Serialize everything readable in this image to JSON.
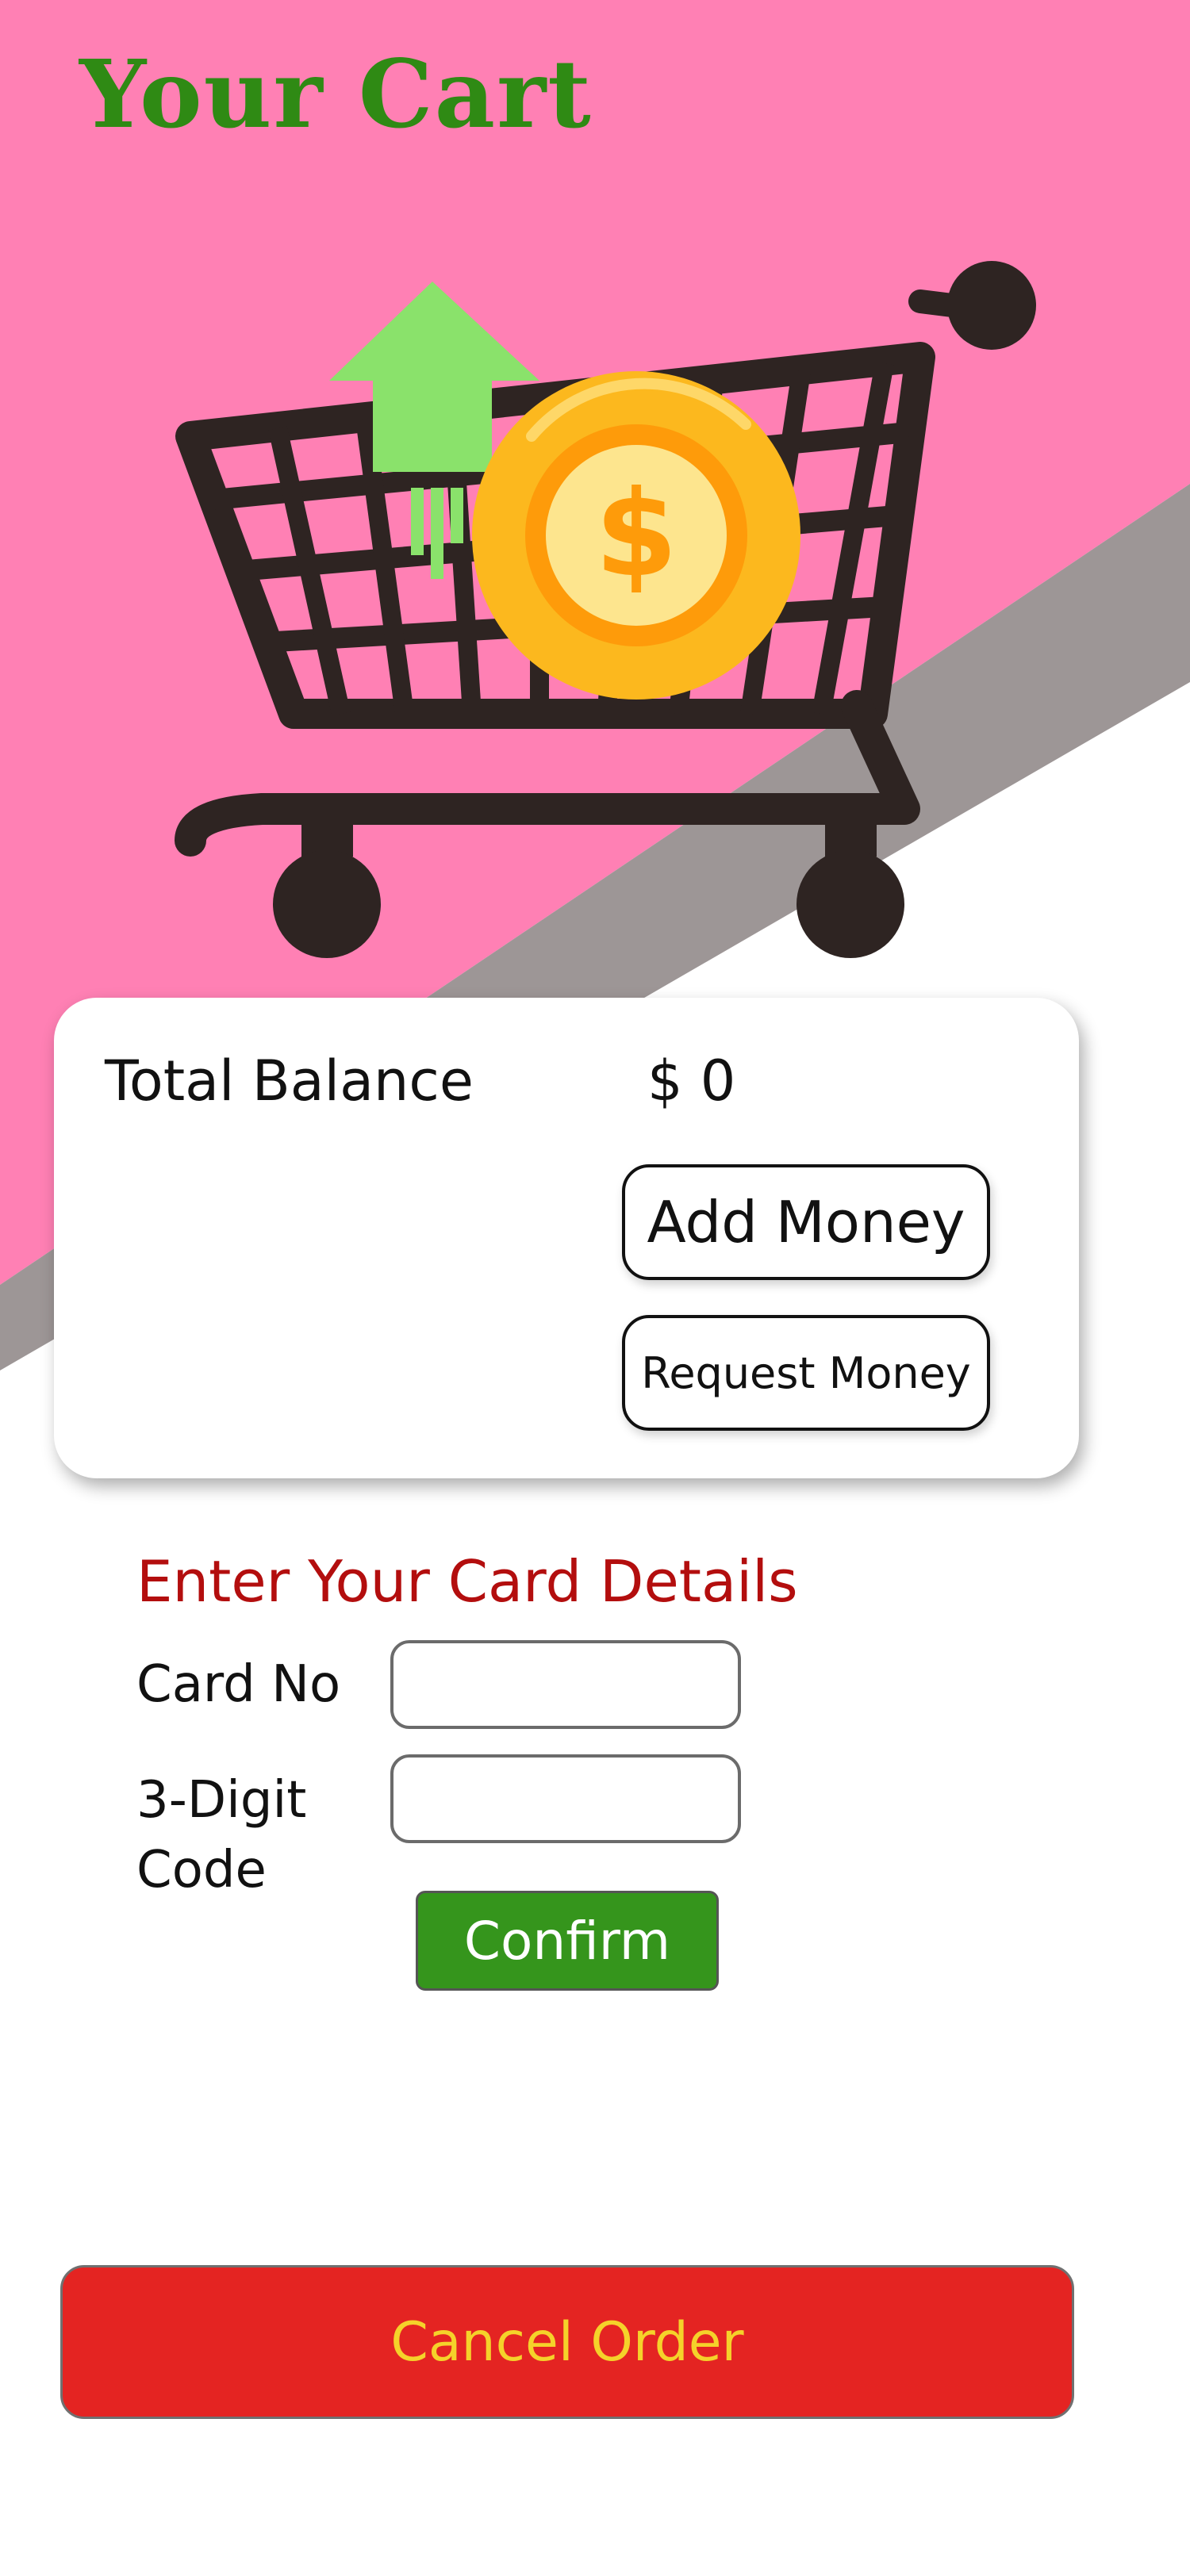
{
  "colors": {
    "pink_background": "#ff80b4",
    "gray_stripe": "#9d9696",
    "title_green": "#2f8a14",
    "card_title_red": "#b30e0e",
    "confirm_green": "#35951c",
    "cancel_red": "#e42422",
    "cancel_text_yellow": "#f5d22a"
  },
  "header": {
    "title": "Your Cart"
  },
  "hero": {
    "icon": "shopping-cart-dollar-coin-illustration"
  },
  "balance": {
    "label": "Total Balance",
    "value": "$ 0",
    "add_money_label": "Add Money",
    "request_money_label": "Request Money"
  },
  "payment": {
    "title": "Enter Your Card Details",
    "card_no_label": "Card No",
    "card_no_value": "",
    "code_label": "3-Digit Code",
    "code_value": "",
    "confirm_label": "Confirm"
  },
  "footer": {
    "cancel_label": "Cancel Order"
  }
}
